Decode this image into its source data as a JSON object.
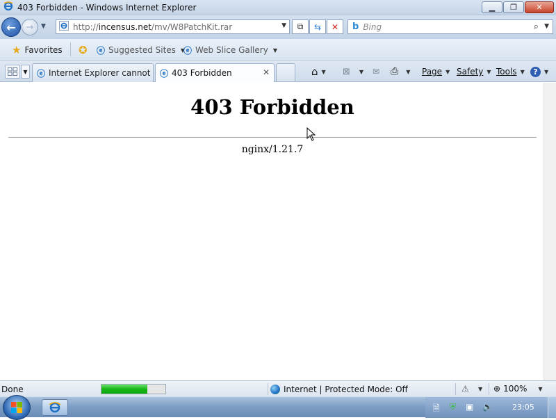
{
  "window": {
    "title": "403 Forbidden - Windows Internet Explorer"
  },
  "nav": {
    "url_prefix": "http://",
    "url_domain": "incensus.net",
    "url_path": "/mv/W8PatchKit.rar",
    "search_placeholder": "Bing"
  },
  "favorites_bar": {
    "favorites_label": "Favorites",
    "suggested_sites": "Suggested Sites",
    "web_slice_gallery": "Web Slice Gallery"
  },
  "tabs": [
    {
      "title": "Internet Explorer cannot d...",
      "active": false
    },
    {
      "title": "403 Forbidden",
      "active": true
    }
  ],
  "commands": {
    "page": "Page",
    "safety": "Safety",
    "tools": "Tools"
  },
  "page": {
    "heading": "403 Forbidden",
    "server": "nginx/1.21.7"
  },
  "status": {
    "text": "Done",
    "progress": 0.72,
    "zone": "Internet | Protected Mode: Off",
    "zoom": "100%"
  },
  "taskbar": {
    "clock": "23:05"
  },
  "colors": {
    "ie_blue": "#1f6fc5",
    "progress_green": "#16b816",
    "close_red": "#c7442b"
  }
}
